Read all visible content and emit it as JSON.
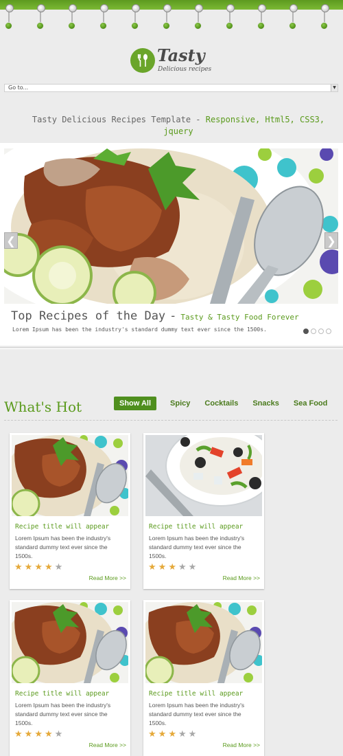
{
  "logo": {
    "title": "Tasty",
    "subtitle": "Delicious recipes"
  },
  "nav": {
    "select_value": "Go to..."
  },
  "tagline": {
    "part1": "Tasty Delicious Recipes Template - ",
    "part2": "Responsive, Html5, CSS3, jquery"
  },
  "slider": {
    "title": "Top Recipes of the Day",
    "separator": "-",
    "subtitle": "Tasty & Tasty Food Forever",
    "text": "Lorem Ipsum has been the industry's standard dummy text ever since the 1500s.",
    "prev_icon": "chevron-left-icon",
    "next_icon": "chevron-right-icon",
    "pager_count": 4,
    "active_index": 0
  },
  "hot": {
    "title": "What's Hot",
    "filters": [
      "Show All",
      "Spicy",
      "Cocktails",
      "Snacks",
      "Sea Food"
    ],
    "active_filter": "Show All"
  },
  "cards": [
    {
      "title": "Recipe title will appear",
      "text": "Lorem Ipsum has been the industry's standard dummy text ever since the 1500s.",
      "rating": 4,
      "max_rating": 5,
      "link": "Read More >>",
      "image": "rice-chicken-plate"
    },
    {
      "title": "Recipe title will appear",
      "text": "Lorem Ipsum has been the industry's standard dummy text ever since the 1500s.",
      "rating": 3,
      "max_rating": 5,
      "link": "Read More >>",
      "image": "salad-bowl"
    },
    {
      "title": "Recipe title will appear",
      "text": "Lorem Ipsum has been the industry's standard dummy text ever since the 1500s.",
      "rating": 4,
      "max_rating": 5,
      "link": "Read More >>",
      "image": "rice-chicken-plate"
    },
    {
      "title": "Recipe title will appear",
      "text": "Lorem Ipsum has been the industry's standard dummy text ever since the 1500s.",
      "rating": 3,
      "max_rating": 5,
      "link": "Read More >>",
      "image": "rice-chicken-plate"
    }
  ],
  "colors": {
    "accent": "#5a9a1c",
    "band": "#6aa52a",
    "star": "#e5a93a"
  }
}
